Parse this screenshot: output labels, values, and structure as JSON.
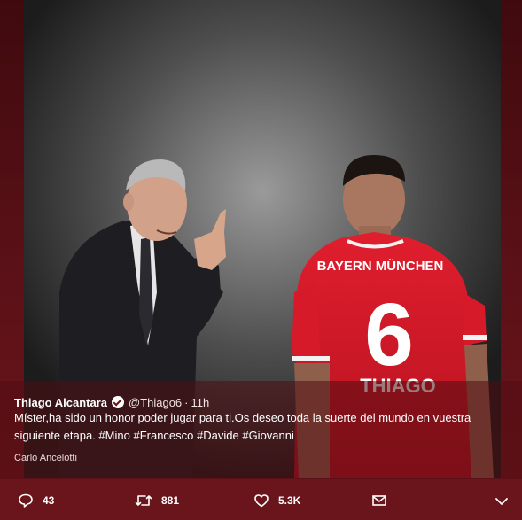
{
  "tweet": {
    "author_name": "Thiago Alcantara",
    "handle": "@Thiago6",
    "separator": "·",
    "time": "11h",
    "text_line1": "Míster,ha sido un honor poder jugar para ti.Os deseo toda la suerte del mundo en vuestra",
    "text_line2_prefix": "siguiente etapa.",
    "hashtags": [
      "#Mino",
      "#Francesco",
      "#Davide",
      "#Giovanni"
    ],
    "photo_caption": "Carlo Ancelotti"
  },
  "photo": {
    "jersey_text": "BAYERN MÜNCHEN",
    "jersey_number": "6",
    "jersey_name": "THIAGO"
  },
  "actions": {
    "reply_count": "43",
    "retweet_count": "881",
    "like_count": "5.3K"
  },
  "icons": {
    "reply": "reply-icon",
    "retweet": "retweet-icon",
    "like": "heart-icon",
    "dm": "envelope-icon",
    "more": "chevron-down-icon"
  },
  "colors": {
    "frame": "#5a1117",
    "jersey_red": "#d61a2a"
  }
}
